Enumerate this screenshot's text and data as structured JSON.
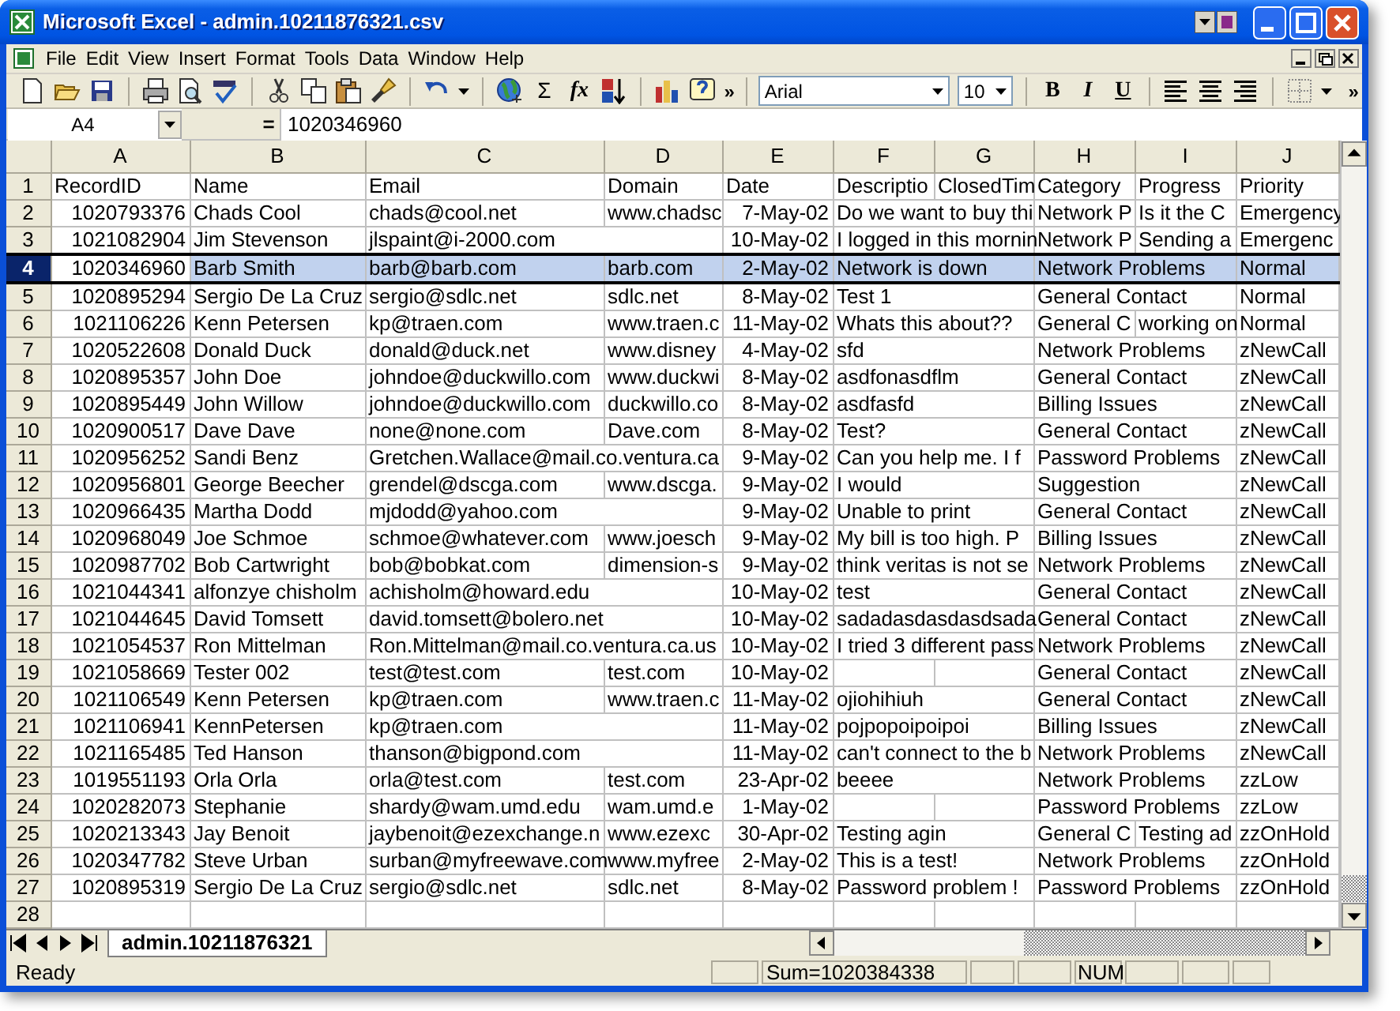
{
  "window": {
    "title": "Microsoft Excel - admin.10211876321.csv"
  },
  "menu": [
    "File",
    "Edit",
    "View",
    "Insert",
    "Format",
    "Tools",
    "Data",
    "Window",
    "Help"
  ],
  "toolbar": {
    "sum": "Σ",
    "function": "fx",
    "overflow": "»",
    "font": "Arial",
    "size": "10",
    "bold": "B",
    "italic": "I",
    "underline": "U",
    "overflow_right": "»"
  },
  "formula_bar": {
    "name_box": "A4",
    "equals": "=",
    "value": "1020346960"
  },
  "columns": [
    {
      "letter": "A",
      "kind": "numeric"
    },
    {
      "letter": "B",
      "kind": "text"
    },
    {
      "letter": "C",
      "kind": "text"
    },
    {
      "letter": "D",
      "kind": "text"
    },
    {
      "letter": "E",
      "kind": "date"
    },
    {
      "letter": "F",
      "kind": "text"
    },
    {
      "letter": "G",
      "kind": "text"
    },
    {
      "letter": "H",
      "kind": "text"
    },
    {
      "letter": "I",
      "kind": "text"
    },
    {
      "letter": "J",
      "kind": "text"
    }
  ],
  "header_row": {
    "number": "1",
    "cells": {
      "A": "RecordID",
      "B": "Name",
      "C": "Email",
      "D": "Domain",
      "E": "Date",
      "F": "Descriptio",
      "G": "ClosedTim",
      "H": "Category",
      "I": "Progress",
      "J": "Priority"
    }
  },
  "rows": [
    {
      "number": "2",
      "selected": false,
      "cells": {
        "A": "1020793376",
        "B": "Chads Cool",
        "C": "chads@cool.net",
        "D": "www.chadsc",
        "E": "7-May-02",
        "F": "Do we want to buy thi",
        "H": "Network P",
        "I": "Is it the C",
        "J": "Emergency"
      }
    },
    {
      "number": "3",
      "selected": false,
      "cells": {
        "A": "1021082904",
        "B": "Jim Stevenson",
        "C": "jlspaint@i-2000.com",
        "E": "10-May-02",
        "F": "I logged in this mornin",
        "H": "Network P",
        "I": "Sending a",
        "J": "Emergenc"
      }
    },
    {
      "number": "4",
      "selected": true,
      "cells": {
        "A": "1020346960",
        "B": "Barb Smith",
        "C": "barb@barb.com",
        "D": "barb.com",
        "E": "2-May-02",
        "F": "Network is down",
        "H": "Network Problems",
        "J": "Normal"
      }
    },
    {
      "number": "5",
      "selected": false,
      "cells": {
        "A": "1020895294",
        "B": "Sergio De La Cruz",
        "C": "sergio@sdlc.net",
        "D": "sdlc.net",
        "E": "8-May-02",
        "F": "Test 1",
        "H": "General Contact",
        "J": "Normal"
      }
    },
    {
      "number": "6",
      "selected": false,
      "cells": {
        "A": "1021106226",
        "B": "Kenn Petersen",
        "C": "kp@traen.com",
        "D": "www.traen.c",
        "E": "11-May-02",
        "F": "Whats this about??",
        "H": "General C",
        "I": "working on",
        "J": "Normal"
      }
    },
    {
      "number": "7",
      "selected": false,
      "cells": {
        "A": "1020522608",
        "B": "Donald Duck",
        "C": "donald@duck.net",
        "D": "www.disney",
        "E": "4-May-02",
        "F": "sfd",
        "H": "Network Problems",
        "J": "zNewCall"
      }
    },
    {
      "number": "8",
      "selected": false,
      "cells": {
        "A": "1020895357",
        "B": "John Doe",
        "C": "johndoe@duckwillo.com",
        "D": "www.duckwi",
        "E": "8-May-02",
        "F": "asdfonasdflm",
        "H": "General Contact",
        "J": "zNewCall"
      }
    },
    {
      "number": "9",
      "selected": false,
      "cells": {
        "A": "1020895449",
        "B": "John Willow",
        "C": "johndoe@duckwillo.com",
        "D": "duckwillo.co",
        "E": "8-May-02",
        "F": "asdfasfd",
        "H": "Billing Issues",
        "J": "zNewCall"
      }
    },
    {
      "number": "10",
      "selected": false,
      "cells": {
        "A": "1020900517",
        "B": "Dave Dave",
        "C": "none@none.com",
        "D": "Dave.com",
        "E": "8-May-02",
        "F": "Test?",
        "H": "General Contact",
        "J": "zNewCall"
      }
    },
    {
      "number": "11",
      "selected": false,
      "cells": {
        "A": "1020956252",
        "B": "Sandi Benz",
        "C": "Gretchen.Wallace@mail.co.ventura.ca",
        "E": "9-May-02",
        "F": "Can you help me.  I f",
        "H": "Password Problems",
        "J": "zNewCall"
      }
    },
    {
      "number": "12",
      "selected": false,
      "cells": {
        "A": "1020956801",
        "B": "George Beecher",
        "C": "grendel@dscga.com",
        "D": "www.dscga.",
        "E": "9-May-02",
        "F": "I would",
        "H": "Suggestion",
        "J": "zNewCall"
      }
    },
    {
      "number": "13",
      "selected": false,
      "cells": {
        "A": "1020966435",
        "B": "Martha Dodd",
        "C": "mjdodd@yahoo.com",
        "E": "9-May-02",
        "F": "Unable to print",
        "H": "General Contact",
        "J": "zNewCall"
      }
    },
    {
      "number": "14",
      "selected": false,
      "cells": {
        "A": "1020968049",
        "B": "Joe Schmoe",
        "C": "schmoe@whatever.com",
        "D": "www.joesch",
        "E": "9-May-02",
        "F": "My bill is too high.  P",
        "H": "Billing Issues",
        "J": "zNewCall"
      }
    },
    {
      "number": "15",
      "selected": false,
      "cells": {
        "A": "1020987702",
        "B": "Bob Cartwright",
        "C": "bob@bobkat.com",
        "D": "dimension-s",
        "E": "9-May-02",
        "F": "think veritas is not se",
        "H": "Network Problems",
        "J": "zNewCall"
      }
    },
    {
      "number": "16",
      "selected": false,
      "cells": {
        "A": "1021044341",
        "B": "alfonzye chisholm",
        "C": "achisholm@howard.edu",
        "E": "10-May-02",
        "F": "test",
        "H": "General Contact",
        "J": "zNewCall"
      }
    },
    {
      "number": "17",
      "selected": false,
      "cells": {
        "A": "1021044645",
        "B": "David Tomsett",
        "C": "david.tomsett@bolero.net",
        "E": "10-May-02",
        "F": "sadadasdasdasdsada",
        "H": "General Contact",
        "J": "zNewCall"
      }
    },
    {
      "number": "18",
      "selected": false,
      "cells": {
        "A": "1021054537",
        "B": "Ron Mittelman",
        "C": "Ron.Mittelman@mail.co.ventura.ca.us",
        "E": "10-May-02",
        "F": "I tried 3 different pass",
        "H": "Network Problems",
        "J": "zNewCall"
      }
    },
    {
      "number": "19",
      "selected": false,
      "cells": {
        "A": "1021058669",
        "B": "Tester 002",
        "C": "test@test.com",
        "D": "test.com",
        "E": "10-May-02",
        "H": "General Contact",
        "J": "zNewCall"
      }
    },
    {
      "number": "20",
      "selected": false,
      "cells": {
        "A": "1021106549",
        "B": "Kenn Petersen",
        "C": "kp@traen.com",
        "D": "www.traen.c",
        "E": "11-May-02",
        "F": "ojiohihiuh",
        "H": "General Contact",
        "J": "zNewCall"
      }
    },
    {
      "number": "21",
      "selected": false,
      "cells": {
        "A": "1021106941",
        "B": "KennPetersen",
        "C": "kp@traen.com",
        "E": "11-May-02",
        "F": "pojpopoipoipoi",
        "H": "Billing Issues",
        "J": "zNewCall"
      }
    },
    {
      "number": "22",
      "selected": false,
      "cells": {
        "A": "1021165485",
        "B": "Ted Hanson",
        "C": "thanson@bigpond.com",
        "E": "11-May-02",
        "F": "can't connect to the b",
        "H": "Network Problems",
        "J": "zNewCall"
      }
    },
    {
      "number": "23",
      "selected": false,
      "cells": {
        "A": "1019551193",
        "B": "Orla Orla",
        "C": "orla@test.com",
        "D": "test.com",
        "E": "23-Apr-02",
        "F": "beeee",
        "H": "Network Problems",
        "J": "zzLow"
      }
    },
    {
      "number": "24",
      "selected": false,
      "cells": {
        "A": "1020282073",
        "B": "Stephanie",
        "C": "shardy@wam.umd.edu",
        "D": "wam.umd.e",
        "E": "1-May-02",
        "H": "Password Problems",
        "J": "zzLow"
      }
    },
    {
      "number": "25",
      "selected": false,
      "cells": {
        "A": "1020213343",
        "B": "Jay Benoit",
        "C": "jaybenoit@ezexchange.n",
        "D": "www.ezexc",
        "E": "30-Apr-02",
        "F": "Testing agin",
        "H": "General C",
        "I": "Testing ad",
        "J": "zzOnHold"
      }
    },
    {
      "number": "26",
      "selected": false,
      "cells": {
        "A": "1020347782",
        "B": "Steve Urban",
        "C": "surban@myfreewave.com",
        "D": "www.myfree",
        "E": "2-May-02",
        "F": "This is a test!",
        "H": "Network Problems",
        "J": "zzOnHold"
      }
    },
    {
      "number": "27",
      "selected": false,
      "cells": {
        "A": "1020895319",
        "B": "Sergio De La Cruz",
        "C": "sergio@sdlc.net",
        "D": "sdlc.net",
        "E": "8-May-02",
        "F": "Password problem !",
        "H": "Password Problems",
        "J": "zzOnHold"
      }
    },
    {
      "number": "28",
      "selected": false
    }
  ],
  "sheet_tabs": [
    {
      "label": "admin.10211876321",
      "selected": true
    }
  ],
  "status_bar": {
    "status": "Ready",
    "sum": "Sum=1020384338",
    "num": "NUM"
  }
}
